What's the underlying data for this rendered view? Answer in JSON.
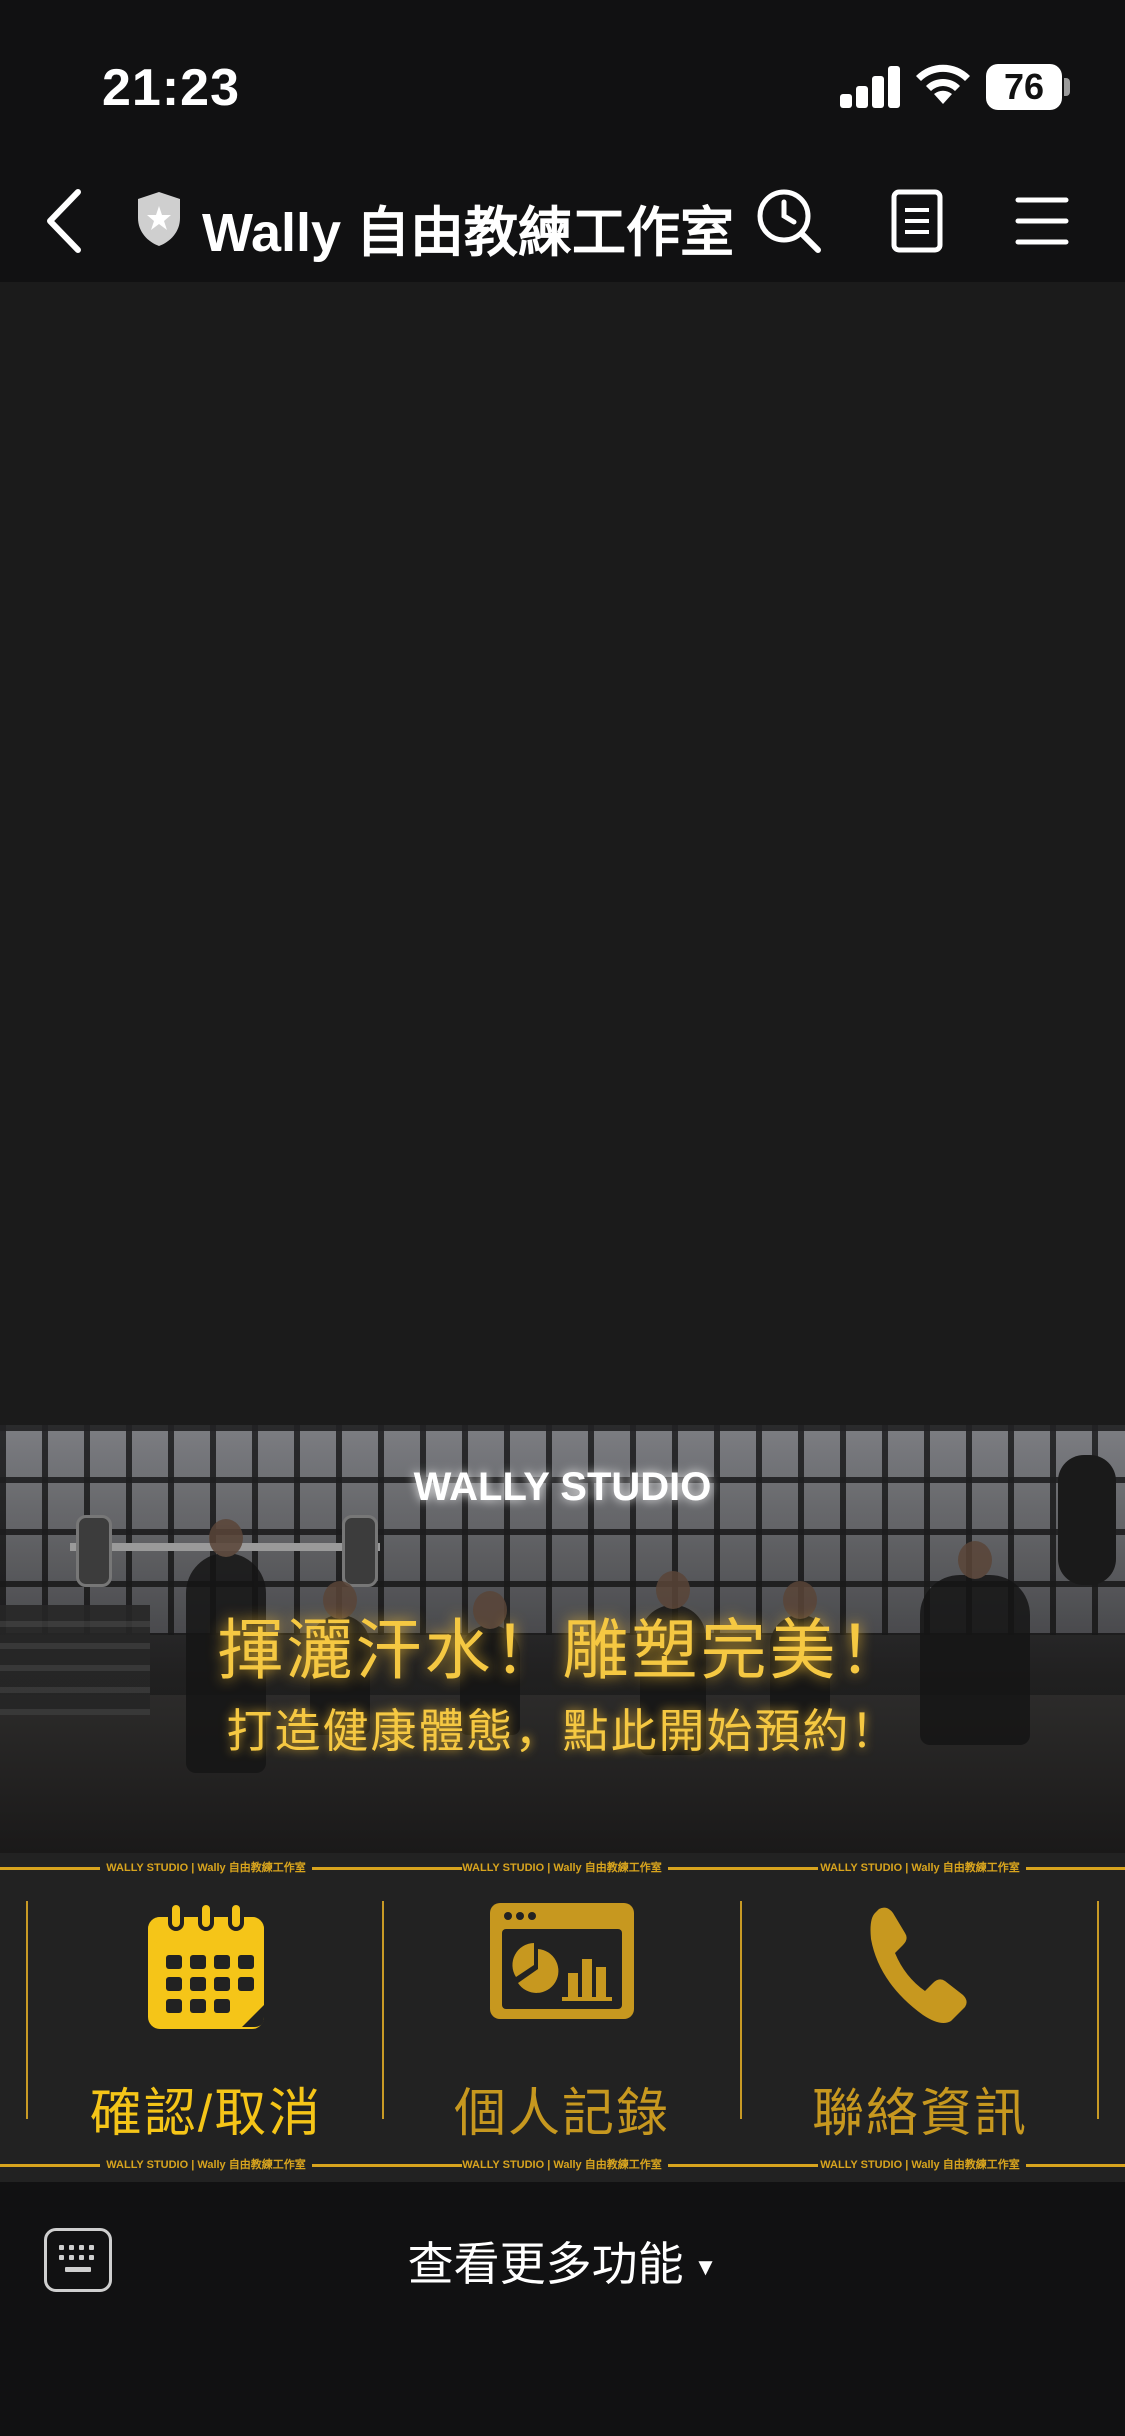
{
  "status": {
    "time": "21:23",
    "battery": "76"
  },
  "nav": {
    "title": "Wally 自由教練工作室"
  },
  "banner": {
    "brand": "WALLY STUDIO",
    "headline": "揮灑汗水！雕塑完美！",
    "subline": "打造健康體態，點此開始預約！"
  },
  "strip_text": "WALLY STUDIO | Wally 自由教練工作室",
  "menu": {
    "buttons": [
      {
        "label": "確認/取消",
        "icon": "calendar-icon",
        "color": "#f5c518"
      },
      {
        "label": "個人記錄",
        "icon": "chart-window-icon",
        "color": "#c7981f"
      },
      {
        "label": "聯絡資訊",
        "icon": "phone-icon",
        "color": "#c7981f"
      }
    ]
  },
  "bottom": {
    "more_label": "查看更多功能",
    "caret": "▼"
  },
  "colors": {
    "accent": "#f5c518",
    "accent_dim": "#c7981f",
    "bar": "#111112",
    "chat_bg": "#1b1b1b"
  }
}
